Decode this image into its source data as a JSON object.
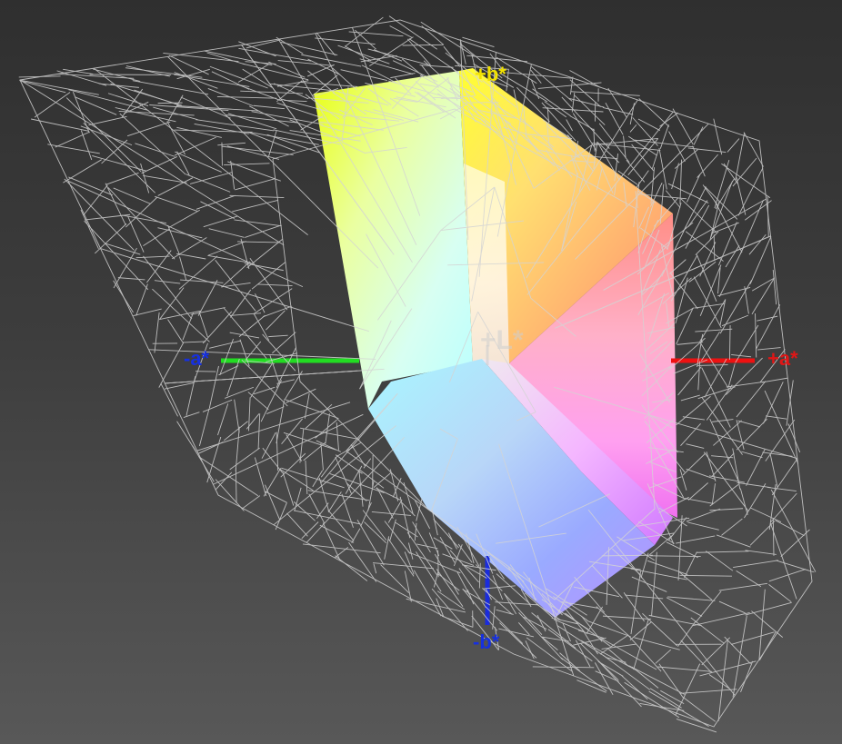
{
  "axes": {
    "plus_b": "+b*",
    "minus_b": "-b*",
    "minus_a": "-a*",
    "plus_a": "+a*",
    "plus_l": "+L*"
  },
  "colors": {
    "plus_b": "#f2e200",
    "minus_b": "#1630e0",
    "minus_a": "#1630e0",
    "plus_a": "#e01616",
    "plus_l": "#cfcfcf",
    "axis_green": "#22dd22",
    "axis_red": "#ee1111",
    "axis_blue": "#1a2cdd",
    "wire": "#d4d4d4"
  }
}
